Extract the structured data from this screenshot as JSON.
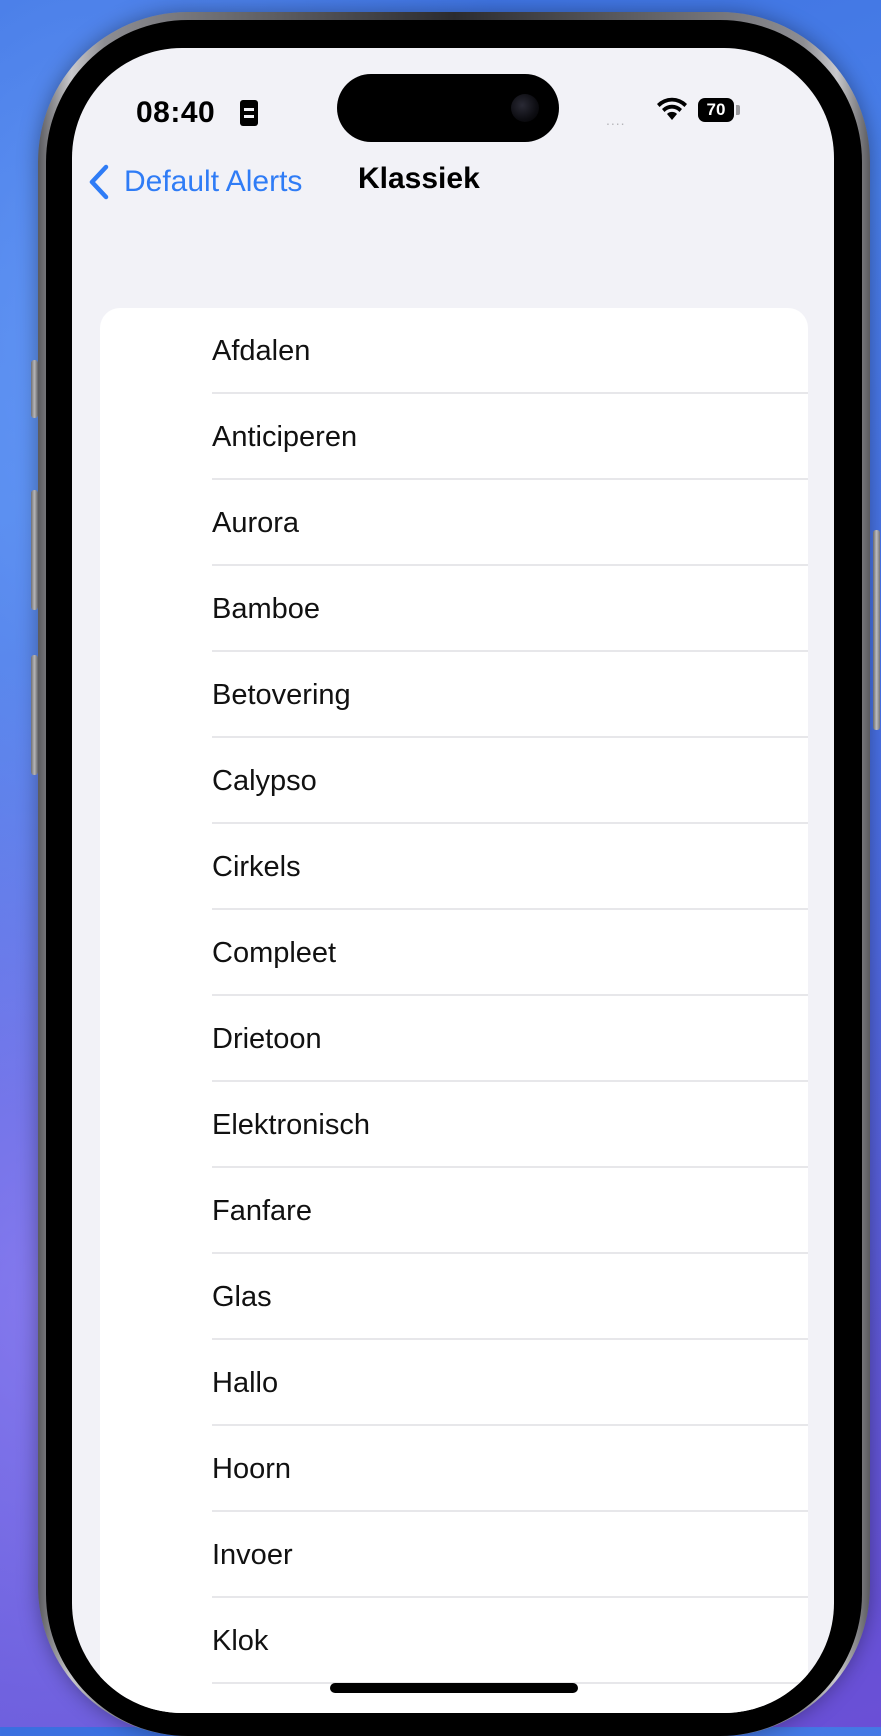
{
  "status_bar": {
    "time": "08:40",
    "signal_dots": "....",
    "battery_level": "70"
  },
  "nav": {
    "back_label": "Default Alerts",
    "title": "Klassiek"
  },
  "tones": [
    {
      "label": "Afdalen"
    },
    {
      "label": "Anticiperen"
    },
    {
      "label": "Aurora"
    },
    {
      "label": "Bamboe"
    },
    {
      "label": "Betovering"
    },
    {
      "label": "Calypso"
    },
    {
      "label": "Cirkels"
    },
    {
      "label": "Compleet"
    },
    {
      "label": "Drietoon"
    },
    {
      "label": "Elektronisch"
    },
    {
      "label": "Fanfare"
    },
    {
      "label": "Glas"
    },
    {
      "label": "Hallo"
    },
    {
      "label": "Hoorn"
    },
    {
      "label": "Invoer"
    },
    {
      "label": "Klok"
    }
  ],
  "colors": {
    "accent": "#2f7cf6",
    "screen_bg": "#f2f2f7",
    "list_bg": "#ffffff",
    "divider": "#e7e7ea"
  },
  "icons": {
    "back": "chevron-left-icon",
    "wifi": "wifi-icon",
    "battery": "battery-icon",
    "sim": "sim-card-icon"
  }
}
